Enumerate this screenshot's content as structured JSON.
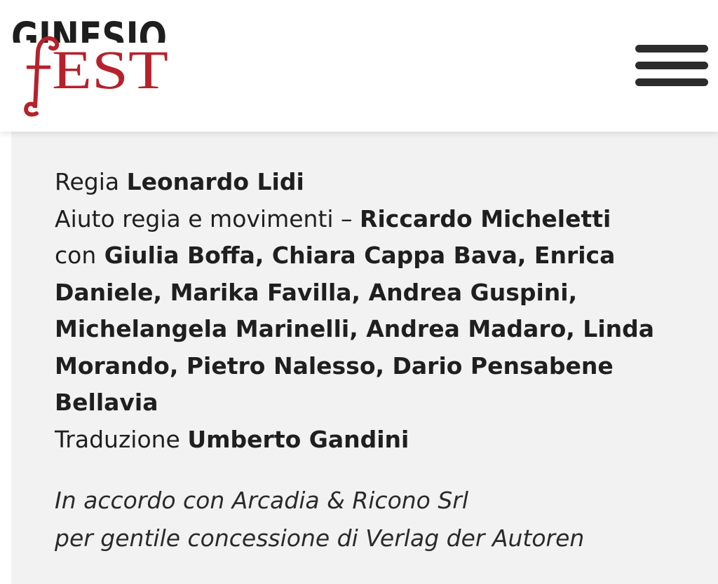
{
  "header": {
    "logo": {
      "top_text": "GINESIO",
      "bottom_text": "fEST"
    },
    "menu_icon": "hamburger-menu-icon"
  },
  "credits": {
    "regia": {
      "role": "Regia",
      "name": "Leonardo Lidi"
    },
    "aiuto": {
      "role": "Aiuto regia e movimenti –",
      "name": "Riccardo Micheletti"
    },
    "cast": {
      "role": "con",
      "names_line1": "Giulia Boffa, Chiara Cappa Bava, Enrica",
      "names_line2": "Daniele, Marika Favilla, Andrea Guspini,",
      "names_line3": "Michelangela Marinelli, Andrea Madaro, Linda",
      "names_line4": "Morando, Pietro Nalesso, Dario Pensabene",
      "names_line5": "Bellavia"
    },
    "traduzione": {
      "role": "Traduzione",
      "name": "Umberto Gandini"
    }
  },
  "notes": {
    "line1": "In accordo con Arcadia & Ricono Srl",
    "line2": "per gentile concessione di Verlag der Autoren"
  },
  "colors": {
    "logo_dark": "#1e1e1e",
    "logo_red": "#b5222c",
    "content_bg": "#f2f2f2",
    "text": "#1f1f1f"
  }
}
